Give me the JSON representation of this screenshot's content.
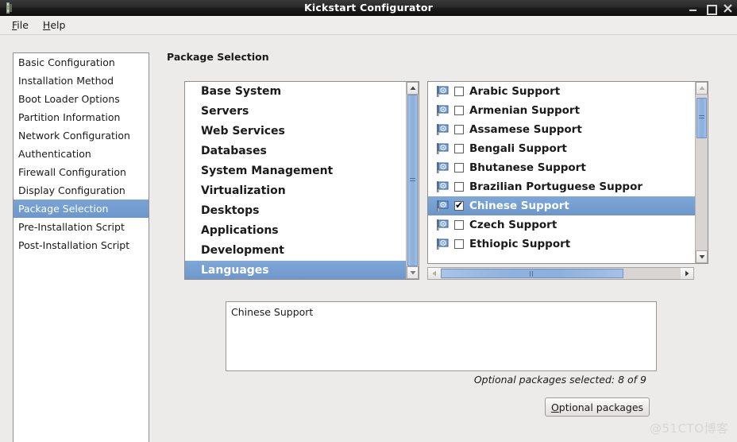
{
  "window": {
    "title": "Kickstart Configurator",
    "app_icon": "kickstart-icon",
    "controls": {
      "minimize": "minimize-icon",
      "maximize": "maximize-icon",
      "close": "close-icon"
    }
  },
  "menubar": {
    "items": [
      {
        "label": "File",
        "accel": "F"
      },
      {
        "label": "Help",
        "accel": "H"
      }
    ]
  },
  "sidebar": {
    "items": [
      {
        "label": "Basic Configuration",
        "selected": false
      },
      {
        "label": "Installation Method",
        "selected": false
      },
      {
        "label": "Boot Loader Options",
        "selected": false
      },
      {
        "label": "Partition Information",
        "selected": false
      },
      {
        "label": "Network Configuration",
        "selected": false
      },
      {
        "label": "Authentication",
        "selected": false
      },
      {
        "label": "Firewall Configuration",
        "selected": false
      },
      {
        "label": "Display Configuration",
        "selected": false
      },
      {
        "label": "Package Selection",
        "selected": true
      },
      {
        "label": "Pre-Installation Script",
        "selected": false
      },
      {
        "label": "Post-Installation Script",
        "selected": false
      }
    ]
  },
  "main": {
    "section_title": "Package Selection",
    "group_list": {
      "items": [
        {
          "label": "Base System",
          "selected": false
        },
        {
          "label": "Servers",
          "selected": false
        },
        {
          "label": "Web Services",
          "selected": false
        },
        {
          "label": "Databases",
          "selected": false
        },
        {
          "label": "System Management",
          "selected": false
        },
        {
          "label": "Virtualization",
          "selected": false
        },
        {
          "label": "Desktops",
          "selected": false
        },
        {
          "label": "Applications",
          "selected": false
        },
        {
          "label": "Development",
          "selected": false
        },
        {
          "label": "Languages",
          "selected": true
        }
      ],
      "scrollbar": {
        "up": "▲",
        "down": "▼",
        "thumb_top_pct": 0,
        "thumb_height_pct": 100
      }
    },
    "package_list": {
      "items": [
        {
          "label": "Arabic Support",
          "checked": false,
          "selected": false,
          "icon": "flag-icon"
        },
        {
          "label": "Armenian Support",
          "checked": false,
          "selected": false,
          "icon": "flag-icon"
        },
        {
          "label": "Assamese Support",
          "checked": false,
          "selected": false,
          "icon": "flag-icon"
        },
        {
          "label": "Bengali Support",
          "checked": false,
          "selected": false,
          "icon": "flag-icon"
        },
        {
          "label": "Bhutanese Support",
          "checked": false,
          "selected": false,
          "icon": "flag-icon"
        },
        {
          "label": "Brazilian Portuguese Suppor",
          "checked": false,
          "selected": false,
          "icon": "flag-icon"
        },
        {
          "label": "Chinese Support",
          "checked": true,
          "selected": true,
          "icon": "flag-icon"
        },
        {
          "label": "Czech Support",
          "checked": false,
          "selected": false,
          "icon": "flag-icon"
        },
        {
          "label": "Ethiopic Support",
          "checked": false,
          "selected": false,
          "icon": "flag-icon"
        }
      ],
      "vscrollbar": {
        "up": "▲",
        "down": "▼",
        "thumb_top_pct": 2,
        "thumb_height_pct": 26
      },
      "hscrollbar": {
        "left": "‹",
        "right": "›",
        "thumb_left_pct": 0,
        "thumb_width_pct": 76
      }
    },
    "description": "Chinese Support",
    "optional_count_text": "Optional packages selected: 8 of 9",
    "optional_button": {
      "label": "Optional packages",
      "accel": "O"
    }
  },
  "watermark": "@51CTO博客",
  "colors": {
    "selection_blue": "#6c96ca",
    "titlebar_dark": "#1b1b1b",
    "window_bg": "#edebe9",
    "scroll_thumb_blue": "#8fb2de"
  }
}
